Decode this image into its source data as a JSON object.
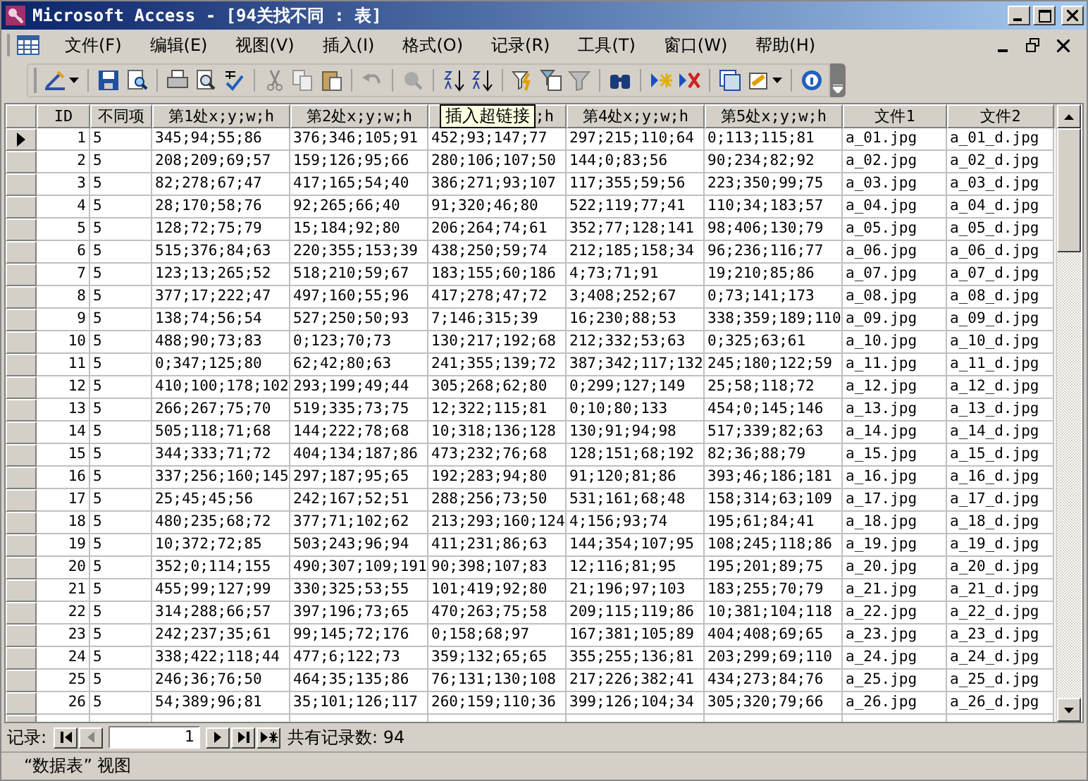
{
  "window": {
    "title": "Microsoft Access - [94关找不同 : 表]"
  },
  "menu": [
    "文件(F)",
    "编辑(E)",
    "视图(V)",
    "插入(I)",
    "格式(O)",
    "记录(R)",
    "工具(T)",
    "窗口(W)",
    "帮助(H)"
  ],
  "table": {
    "columns": [
      "ID",
      "不同项",
      "第1处x;y;w;h",
      "第2处x;y;w;h",
      ";h",
      "第4处x;y;w;h",
      "第5处x;y;w;h",
      "文件1",
      "文件2"
    ],
    "tooltip": "插入超链接",
    "rows": [
      {
        "current": true,
        "cells": [
          "1",
          "5",
          "345;94;55;86",
          "376;346;105;91",
          "452;93;147;77",
          "297;215;110;64",
          "0;113;115;81",
          "a_01.jpg",
          "a_01_d.jpg"
        ]
      },
      {
        "current": false,
        "cells": [
          "2",
          "5",
          "208;209;69;57",
          "159;126;95;66",
          "280;106;107;50",
          "144;0;83;56",
          "90;234;82;92",
          "a_02.jpg",
          "a_02_d.jpg"
        ]
      },
      {
        "current": false,
        "cells": [
          "3",
          "5",
          "82;278;67;47",
          "417;165;54;40",
          "386;271;93;107",
          "117;355;59;56",
          "223;350;99;75",
          "a_03.jpg",
          "a_03_d.jpg"
        ]
      },
      {
        "current": false,
        "cells": [
          "4",
          "5",
          "28;170;58;76",
          "92;265;66;40",
          "91;320;46;80",
          "522;119;77;41",
          "110;34;183;57",
          "a_04.jpg",
          "a_04_d.jpg"
        ]
      },
      {
        "current": false,
        "cells": [
          "5",
          "5",
          "128;72;75;79",
          "15;184;92;80",
          "206;264;74;61",
          "352;77;128;141",
          "98;406;130;79",
          "a_05.jpg",
          "a_05_d.jpg"
        ]
      },
      {
        "current": false,
        "cells": [
          "6",
          "5",
          "515;376;84;63",
          "220;355;153;39",
          "438;250;59;74",
          "212;185;158;34",
          "96;236;116;77",
          "a_06.jpg",
          "a_06_d.jpg"
        ]
      },
      {
        "current": false,
        "cells": [
          "7",
          "5",
          "123;13;265;52",
          "518;210;59;67",
          "183;155;60;186",
          "4;73;71;91",
          "19;210;85;86",
          "a_07.jpg",
          "a_07_d.jpg"
        ]
      },
      {
        "current": false,
        "cells": [
          "8",
          "5",
          "377;17;222;47",
          "497;160;55;96",
          "417;278;47;72",
          "3;408;252;67",
          "0;73;141;173",
          "a_08.jpg",
          "a_08_d.jpg"
        ]
      },
      {
        "current": false,
        "cells": [
          "9",
          "5",
          "138;74;56;54",
          "527;250;50;93",
          "7;146;315;39",
          "16;230;88;53",
          "338;359;189;110",
          "a_09.jpg",
          "a_09_d.jpg"
        ]
      },
      {
        "current": false,
        "cells": [
          "10",
          "5",
          "488;90;73;83",
          "0;123;70;73",
          "130;217;192;68",
          "212;332;53;63",
          "0;325;63;61",
          "a_10.jpg",
          "a_10_d.jpg"
        ]
      },
      {
        "current": false,
        "cells": [
          "11",
          "5",
          "0;347;125;80",
          "62;42;80;63",
          "241;355;139;72",
          "387;342;117;132",
          "245;180;122;59",
          "a_11.jpg",
          "a_11_d.jpg"
        ]
      },
      {
        "current": false,
        "cells": [
          "12",
          "5",
          "410;100;178;102",
          "293;199;49;44",
          "305;268;62;80",
          "0;299;127;149",
          "25;58;118;72",
          "a_12.jpg",
          "a_12_d.jpg"
        ]
      },
      {
        "current": false,
        "cells": [
          "13",
          "5",
          "266;267;75;70",
          "519;335;73;75",
          "12;322;115;81",
          "0;10;80;133",
          "454;0;145;146",
          "a_13.jpg",
          "a_13_d.jpg"
        ]
      },
      {
        "current": false,
        "cells": [
          "14",
          "5",
          "505;118;71;68",
          "144;222;78;68",
          "10;318;136;128",
          "130;91;94;98",
          "517;339;82;63",
          "a_14.jpg",
          "a_14_d.jpg"
        ]
      },
      {
        "current": false,
        "cells": [
          "15",
          "5",
          "344;333;71;72",
          "404;134;187;86",
          "473;232;76;68",
          "128;151;68;192",
          "82;36;88;79",
          "a_15.jpg",
          "a_15_d.jpg"
        ]
      },
      {
        "current": false,
        "cells": [
          "16",
          "5",
          "337;256;160;145",
          "297;187;95;65",
          "192;283;94;80",
          "91;120;81;86",
          "393;46;186;181",
          "a_16.jpg",
          "a_16_d.jpg"
        ]
      },
      {
        "current": false,
        "cells": [
          "17",
          "5",
          "25;45;45;56",
          "242;167;52;51",
          "288;256;73;50",
          "531;161;68;48",
          "158;314;63;109",
          "a_17.jpg",
          "a_17_d.jpg"
        ]
      },
      {
        "current": false,
        "cells": [
          "18",
          "5",
          "480;235;68;72",
          "377;71;102;62",
          "213;293;160;124",
          "4;156;93;74",
          "195;61;84;41",
          "a_18.jpg",
          "a_18_d.jpg"
        ]
      },
      {
        "current": false,
        "cells": [
          "19",
          "5",
          "10;372;72;85",
          "503;243;96;94",
          "411;231;86;63",
          "144;354;107;95",
          "108;245;118;86",
          "a_19.jpg",
          "a_19_d.jpg"
        ]
      },
      {
        "current": false,
        "cells": [
          "20",
          "5",
          "352;0;114;155",
          "490;307;109;191",
          "90;398;107;83",
          "12;116;81;95",
          "195;201;89;75",
          "a_20.jpg",
          "a_20_d.jpg"
        ]
      },
      {
        "current": false,
        "cells": [
          "21",
          "5",
          "455;99;127;99",
          "330;325;53;55",
          "101;419;92;80",
          "21;196;97;103",
          "183;255;70;79",
          "a_21.jpg",
          "a_21_d.jpg"
        ]
      },
      {
        "current": false,
        "cells": [
          "22",
          "5",
          "314;288;66;57",
          "397;196;73;65",
          "470;263;75;58",
          "209;115;119;86",
          "10;381;104;118",
          "a_22.jpg",
          "a_22_d.jpg"
        ]
      },
      {
        "current": false,
        "cells": [
          "23",
          "5",
          "242;237;35;61",
          "99;145;72;176",
          "0;158;68;97",
          "167;381;105;89",
          "404;408;69;65",
          "a_23.jpg",
          "a_23_d.jpg"
        ]
      },
      {
        "current": false,
        "cells": [
          "24",
          "5",
          "338;422;118;44",
          "477;6;122;73",
          "359;132;65;65",
          "355;255;136;81",
          "203;299;69;110",
          "a_24.jpg",
          "a_24_d.jpg"
        ]
      },
      {
        "current": false,
        "cells": [
          "25",
          "5",
          "246;36;76;50",
          "464;35;135;86",
          "76;131;130;108",
          "217;226;382;41",
          "434;273;84;76",
          "a_25.jpg",
          "a_25_d.jpg"
        ]
      },
      {
        "current": false,
        "cells": [
          "26",
          "5",
          "54;389;96;81",
          "35;101;126;117",
          "260;159;110;36",
          "399;126;104;34",
          "305;320;79;66",
          "a_26.jpg",
          "a_26_d.jpg"
        ]
      }
    ]
  },
  "navigator": {
    "label": "记录:",
    "record": "1",
    "total": "共有记录数: 94"
  },
  "status_bar": {
    "text": "“数据表” 视图"
  }
}
